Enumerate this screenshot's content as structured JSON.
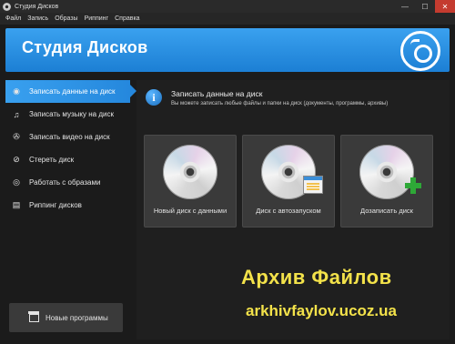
{
  "window": {
    "title": "Студия Дисков",
    "controls": {
      "minimize": "—",
      "maximize": "☐",
      "close": "✕"
    }
  },
  "menu": [
    "Файл",
    "Запись",
    "Образы",
    "Риппинг",
    "Справка"
  ],
  "banner": {
    "title": "Студия Дисков",
    "icon": "disc-icon"
  },
  "sidebar": {
    "items": [
      {
        "label": "Записать данные на диск",
        "icon": "disc-icon",
        "active": true
      },
      {
        "label": "Записать музыку на диск",
        "icon": "music-note-icon",
        "active": false
      },
      {
        "label": "Записать видео на диск",
        "icon": "film-reel-icon",
        "active": false
      },
      {
        "label": "Стереть диск",
        "icon": "erase-icon",
        "active": false
      },
      {
        "label": "Работать с образами",
        "icon": "eye-icon",
        "active": false
      },
      {
        "label": "Риппинг дисков",
        "icon": "document-icon",
        "active": false
      }
    ],
    "new_programs_label": "Новые программы"
  },
  "main": {
    "header_title": "Записать данные на диск",
    "header_subtitle": "Вы можете записать любые файлы и папки на диск (документы, программы, архивы)",
    "tiles": [
      {
        "label": "Новый диск с данными",
        "icon": "cd-icon"
      },
      {
        "label": "Диск с автозапуском",
        "icon": "cd-autorun-icon"
      },
      {
        "label": "Дозаписать диск",
        "icon": "cd-plus-icon"
      }
    ]
  },
  "watermark": {
    "line1": "Архив Файлов",
    "line2": "arkhivfaylov.ucoz.ua"
  },
  "colors": {
    "accent": "#2a8fe4",
    "background": "#1b1b1b",
    "tile": "#3a3a3a",
    "watermark": "#f3e24a"
  }
}
